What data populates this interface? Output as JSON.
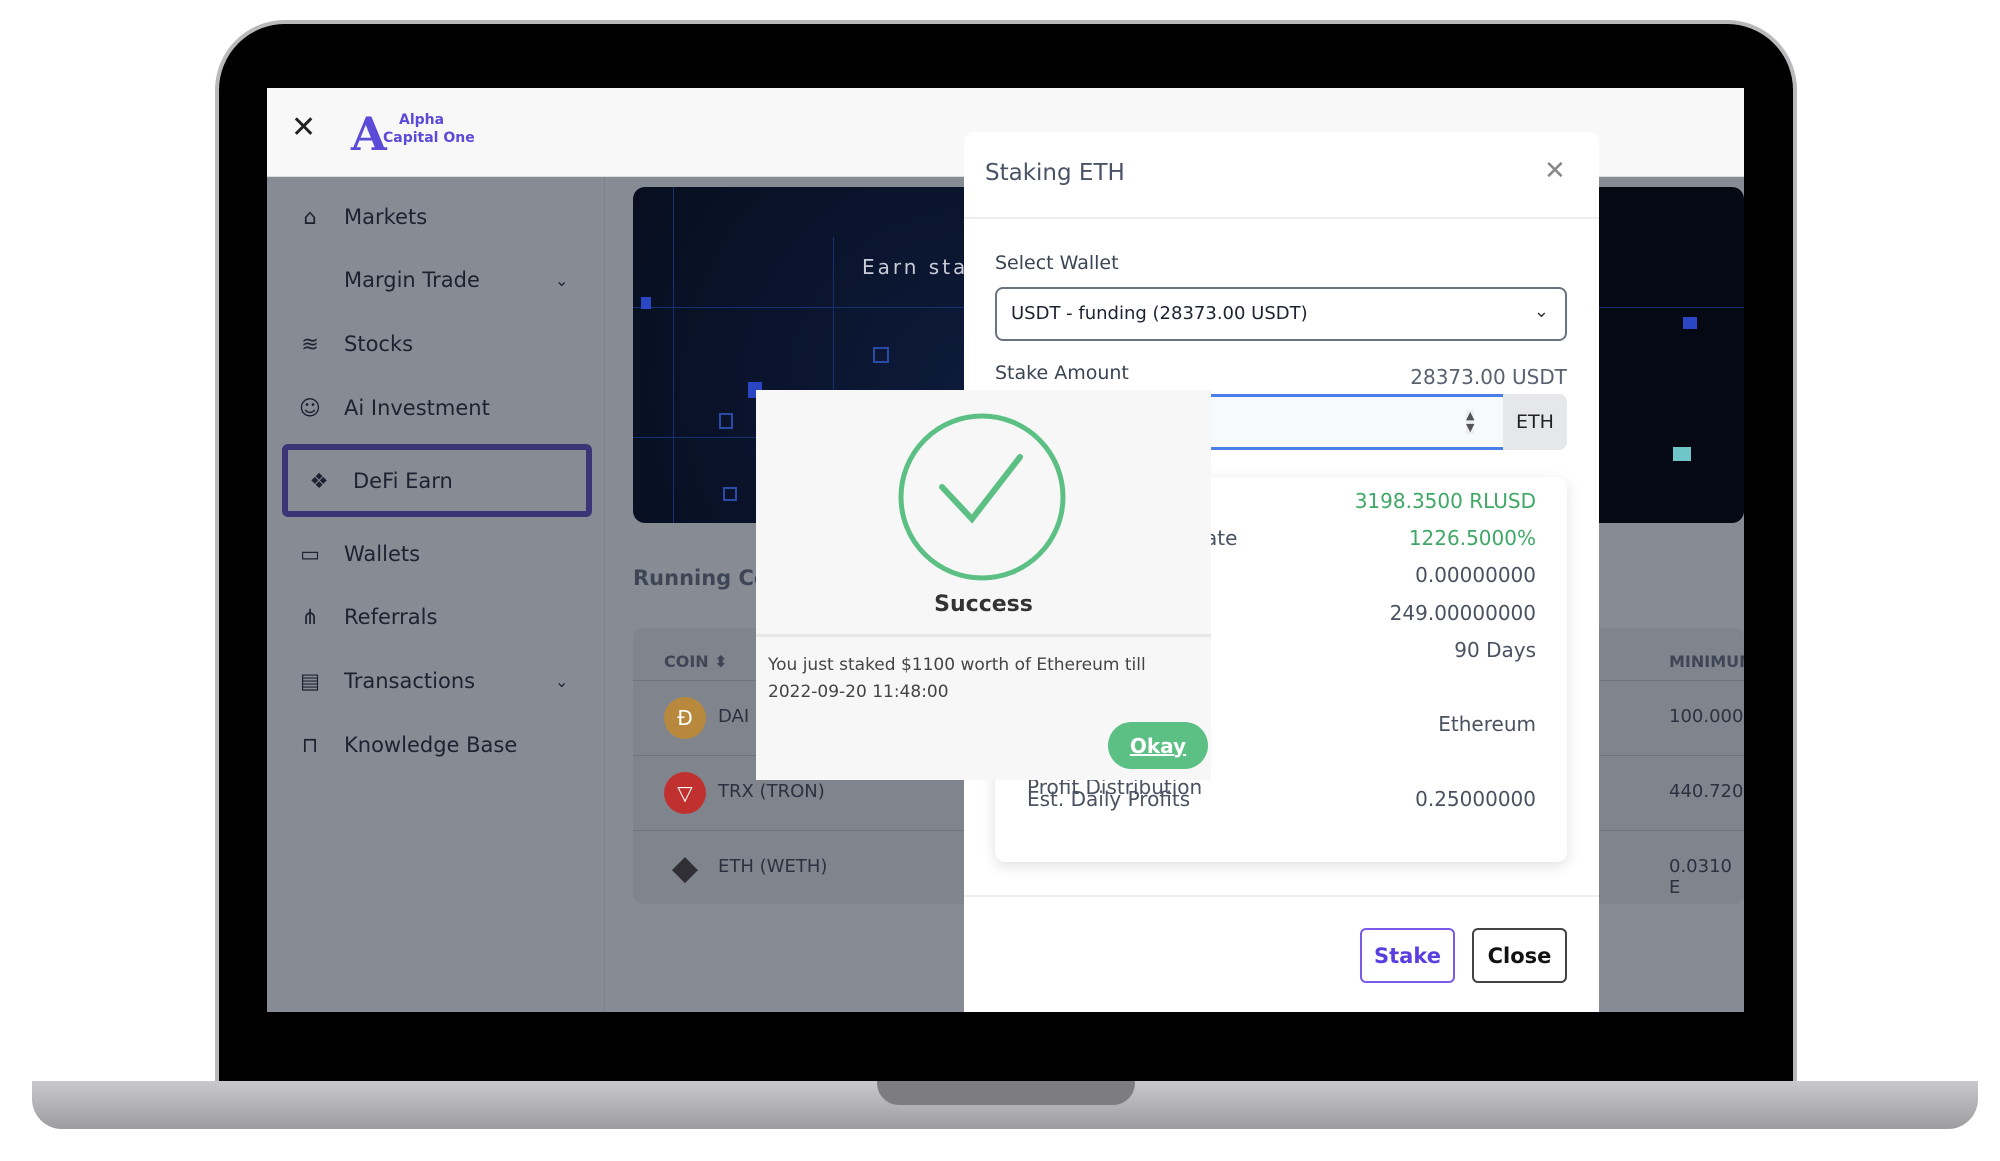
{
  "app": {
    "logo_line1": "Alpha",
    "logo_line2": "Capital One",
    "brand_color": "#5b4bd8"
  },
  "sidebar": {
    "items": [
      {
        "label": "Markets",
        "icon": "home-icon",
        "chevron": false
      },
      {
        "label": "Margin Trade",
        "icon": "",
        "chevron": true
      },
      {
        "label": "Stocks",
        "icon": "stack-icon",
        "chevron": false
      },
      {
        "label": "Ai Investment",
        "icon": "robot-icon",
        "chevron": false
      },
      {
        "label": "DeFi Earn",
        "icon": "cubes-icon",
        "chevron": false,
        "active": true
      },
      {
        "label": "Wallets",
        "icon": "wallet-icon",
        "chevron": false
      },
      {
        "label": "Referrals",
        "icon": "sitemap-icon",
        "chevron": false
      },
      {
        "label": "Transactions",
        "icon": "briefcase-icon",
        "chevron": true
      },
      {
        "label": "Knowledge Base",
        "icon": "book-icon",
        "chevron": false
      }
    ]
  },
  "banner": {
    "text": "Earn stab"
  },
  "main": {
    "section_title": "Running Con",
    "table": {
      "headers": [
        "COIN",
        "MINIMUM"
      ],
      "rows": [
        {
          "coin": "DAI (",
          "minimum": "100.0000",
          "color": "#b8893c"
        },
        {
          "coin": "TRX (TRON)",
          "minimum": "440.7200",
          "color": "#c0302e"
        },
        {
          "coin": "ETH (WETH)",
          "minimum": "0.0310  E",
          "color": "#2f2f35"
        }
      ]
    }
  },
  "modal": {
    "title": "Staking ETH",
    "select_wallet_label": "Select Wallet",
    "select_wallet_value": "USDT - funding (28373.00 USDT)",
    "stake_amount_label": "Stake Amount",
    "balance": "28373.00 USDT",
    "amount_value": "",
    "unit": "ETH",
    "info": [
      {
        "label": "",
        "value": "3198.3500 RLUSD",
        "green": true
      },
      {
        "label": "ate",
        "value": "1226.5000%",
        "green": true
      },
      {
        "label": "",
        "value": "0.00000000"
      },
      {
        "label": "",
        "value": "249.00000000"
      },
      {
        "label": "",
        "value": "90 Days"
      },
      {
        "label": "",
        "value": "Ethereum"
      },
      {
        "label": "Est. Daily Profits",
        "value": "0.25000000"
      }
    ],
    "partial_label": "Profit Distribution",
    "stake_button": "Stake",
    "close_button": "Close"
  },
  "popup": {
    "title": "Success",
    "message": "You just staked $1100 worth of Ethereum till 2022-09-20 11:48:00",
    "okay_button": "Okay",
    "success_color": "#5cc084"
  }
}
